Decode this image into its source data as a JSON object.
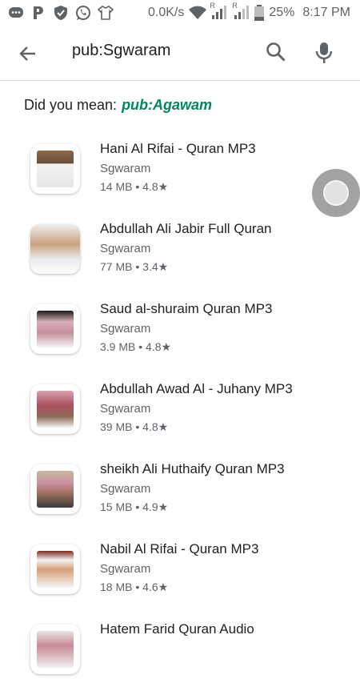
{
  "status_bar": {
    "network_speed": "0.0K/s",
    "signal_1_label": "R",
    "signal_2_label": "R",
    "battery": "25%",
    "time": "8:17 PM",
    "icons": [
      "chat-icon",
      "p-icon",
      "shield-check-icon",
      "whatsapp-icon",
      "shirt-icon",
      "wifi-icon",
      "signal-icon",
      "signal-icon",
      "battery-icon"
    ]
  },
  "search": {
    "query": "pub:Sgwaram",
    "back_icon": "arrow-back-icon",
    "search_icon": "search-icon",
    "mic_icon": "mic-icon"
  },
  "did_you_mean": {
    "label": "Did you mean:",
    "suggestion": "pub:Agawam",
    "suggestion_color": "#01875f"
  },
  "apps": [
    {
      "title": "Hani Al Rifai - Quran MP3",
      "developer": "Sgwaram",
      "size": "14 MB",
      "rating": "4.8",
      "star": "★",
      "sep": "•"
    },
    {
      "title": "Abdullah Ali Jabir Full Quran",
      "developer": "Sgwaram",
      "size": "77 MB",
      "rating": "3.4",
      "star": "★",
      "sep": "•"
    },
    {
      "title": "Saud al-shuraim Quran MP3",
      "developer": "Sgwaram",
      "size": "3.9 MB",
      "rating": "4.8",
      "star": "★",
      "sep": "•"
    },
    {
      "title": "Abdullah Awad Al - Juhany MP3",
      "developer": "Sgwaram",
      "size": "39 MB",
      "rating": "4.8",
      "star": "★",
      "sep": "•"
    },
    {
      "title": "sheikh Ali Huthaify Quran MP3",
      "developer": "Sgwaram",
      "size": "15 MB",
      "rating": "4.9",
      "star": "★",
      "sep": "•"
    },
    {
      "title": "Nabil Al Rifai - Quran MP3",
      "developer": "Sgwaram",
      "size": "18 MB",
      "rating": "4.6",
      "star": "★",
      "sep": "•"
    },
    {
      "title": "Hatem Farid Quran Audio",
      "developer": "",
      "size": "",
      "rating": "",
      "star": "",
      "sep": ""
    }
  ],
  "colors": {
    "text_primary": "#202124",
    "text_secondary": "#5f6368",
    "divider": "#dadce0",
    "floating_button": "#9e9e9e"
  }
}
